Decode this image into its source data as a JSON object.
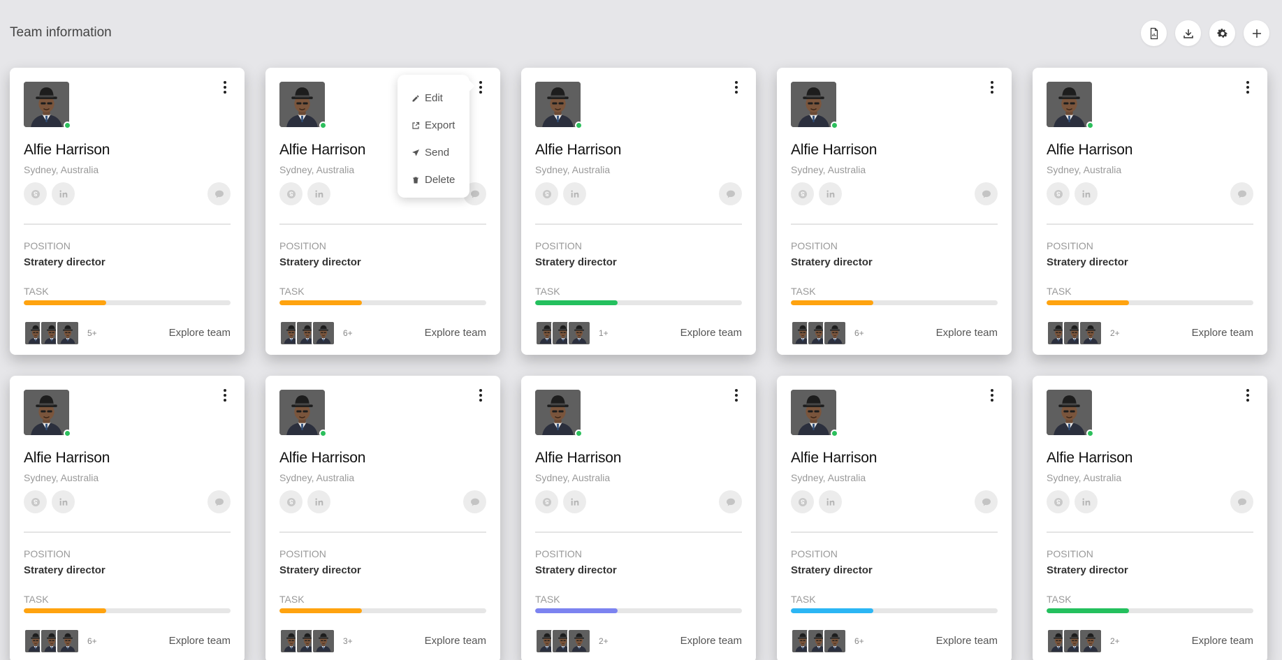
{
  "page": {
    "title": "Team information"
  },
  "toolbar": {
    "buttons": [
      {
        "name": "report-icon"
      },
      {
        "name": "download-icon"
      },
      {
        "name": "gear-icon"
      },
      {
        "name": "plus-icon"
      }
    ]
  },
  "context_menu": {
    "items": [
      {
        "label": "Edit",
        "icon": "pencil-icon"
      },
      {
        "label": "Export",
        "icon": "export-icon"
      },
      {
        "label": "Send",
        "icon": "send-icon"
      },
      {
        "label": "Delete",
        "icon": "trash-icon"
      }
    ]
  },
  "colors": {
    "orange": "#ffa30f",
    "green": "#24c05e",
    "purple": "#7c83f0",
    "blue": "#2cb6f4",
    "status_online": "#2cbf5c"
  },
  "cards": [
    {
      "name": "Alfie Harrison",
      "location": "Sydney, Australia",
      "position_label": "POSITION",
      "position": "Stratery director",
      "task_label": "TASK",
      "progress": 0.4,
      "bar_color": "#ffa30f",
      "team_count": "5+",
      "explore_label": "Explore team"
    },
    {
      "name": "Alfie Harrison",
      "location": "Sydney, Australia",
      "position_label": "POSITION",
      "position": "Stratery director",
      "task_label": "TASK",
      "progress": 0.4,
      "bar_color": "#ffa30f",
      "team_count": "6+",
      "explore_label": "Explore team"
    },
    {
      "name": "Alfie Harrison",
      "location": "Sydney, Australia",
      "position_label": "POSITION",
      "position": "Stratery director",
      "task_label": "TASK",
      "progress": 0.4,
      "bar_color": "#24c05e",
      "team_count": "1+",
      "explore_label": "Explore team"
    },
    {
      "name": "Alfie Harrison",
      "location": "Sydney, Australia",
      "position_label": "POSITION",
      "position": "Stratery director",
      "task_label": "TASK",
      "progress": 0.4,
      "bar_color": "#ffa30f",
      "team_count": "6+",
      "explore_label": "Explore team"
    },
    {
      "name": "Alfie Harrison",
      "location": "Sydney, Australia",
      "position_label": "POSITION",
      "position": "Stratery director",
      "task_label": "TASK",
      "progress": 0.4,
      "bar_color": "#ffa30f",
      "team_count": "2+",
      "explore_label": "Explore team"
    },
    {
      "name": "Alfie Harrison",
      "location": "Sydney, Australia",
      "position_label": "POSITION",
      "position": "Stratery director",
      "task_label": "TASK",
      "progress": 0.4,
      "bar_color": "#ffa30f",
      "team_count": "6+",
      "explore_label": "Explore team"
    },
    {
      "name": "Alfie Harrison",
      "location": "Sydney, Australia",
      "position_label": "POSITION",
      "position": "Stratery director",
      "task_label": "TASK",
      "progress": 0.4,
      "bar_color": "#ffa30f",
      "team_count": "3+",
      "explore_label": "Explore team"
    },
    {
      "name": "Alfie Harrison",
      "location": "Sydney, Australia",
      "position_label": "POSITION",
      "position": "Stratery director",
      "task_label": "TASK",
      "progress": 0.4,
      "bar_color": "#7c83f0",
      "team_count": "2+",
      "explore_label": "Explore team"
    },
    {
      "name": "Alfie Harrison",
      "location": "Sydney, Australia",
      "position_label": "POSITION",
      "position": "Stratery director",
      "task_label": "TASK",
      "progress": 0.4,
      "bar_color": "#2cb6f4",
      "team_count": "6+",
      "explore_label": "Explore team"
    },
    {
      "name": "Alfie Harrison",
      "location": "Sydney, Australia",
      "position_label": "POSITION",
      "position": "Stratery director",
      "task_label": "TASK",
      "progress": 0.4,
      "bar_color": "#24c05e",
      "team_count": "2+",
      "explore_label": "Explore team"
    }
  ]
}
